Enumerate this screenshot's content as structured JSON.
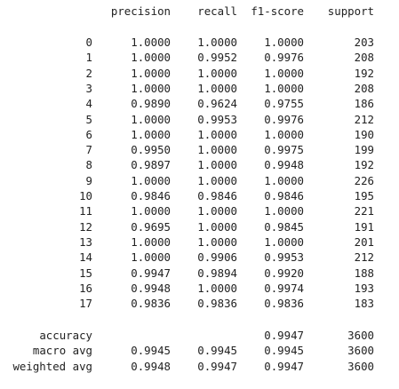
{
  "report": {
    "header": {
      "precision": "precision",
      "recall": "recall",
      "f1": "f1-score",
      "support": "support"
    },
    "classes": [
      {
        "label": "0",
        "precision": "1.0000",
        "recall": "1.0000",
        "f1": "1.0000",
        "support": "203"
      },
      {
        "label": "1",
        "precision": "1.0000",
        "recall": "0.9952",
        "f1": "0.9976",
        "support": "208"
      },
      {
        "label": "2",
        "precision": "1.0000",
        "recall": "1.0000",
        "f1": "1.0000",
        "support": "192"
      },
      {
        "label": "3",
        "precision": "1.0000",
        "recall": "1.0000",
        "f1": "1.0000",
        "support": "208"
      },
      {
        "label": "4",
        "precision": "0.9890",
        "recall": "0.9624",
        "f1": "0.9755",
        "support": "186"
      },
      {
        "label": "5",
        "precision": "1.0000",
        "recall": "0.9953",
        "f1": "0.9976",
        "support": "212"
      },
      {
        "label": "6",
        "precision": "1.0000",
        "recall": "1.0000",
        "f1": "1.0000",
        "support": "190"
      },
      {
        "label": "7",
        "precision": "0.9950",
        "recall": "1.0000",
        "f1": "0.9975",
        "support": "199"
      },
      {
        "label": "8",
        "precision": "0.9897",
        "recall": "1.0000",
        "f1": "0.9948",
        "support": "192"
      },
      {
        "label": "9",
        "precision": "1.0000",
        "recall": "1.0000",
        "f1": "1.0000",
        "support": "226"
      },
      {
        "label": "10",
        "precision": "0.9846",
        "recall": "0.9846",
        "f1": "0.9846",
        "support": "195"
      },
      {
        "label": "11",
        "precision": "1.0000",
        "recall": "1.0000",
        "f1": "1.0000",
        "support": "221"
      },
      {
        "label": "12",
        "precision": "0.9695",
        "recall": "1.0000",
        "f1": "0.9845",
        "support": "191"
      },
      {
        "label": "13",
        "precision": "1.0000",
        "recall": "1.0000",
        "f1": "1.0000",
        "support": "201"
      },
      {
        "label": "14",
        "precision": "1.0000",
        "recall": "0.9906",
        "f1": "0.9953",
        "support": "212"
      },
      {
        "label": "15",
        "precision": "0.9947",
        "recall": "0.9894",
        "f1": "0.9920",
        "support": "188"
      },
      {
        "label": "16",
        "precision": "0.9948",
        "recall": "1.0000",
        "f1": "0.9974",
        "support": "193"
      },
      {
        "label": "17",
        "precision": "0.9836",
        "recall": "0.9836",
        "f1": "0.9836",
        "support": "183"
      }
    ],
    "summary": [
      {
        "label": "accuracy",
        "precision": "",
        "recall": "",
        "f1": "0.9947",
        "support": "3600"
      },
      {
        "label": "macro avg",
        "precision": "0.9945",
        "recall": "0.9945",
        "f1": "0.9945",
        "support": "3600"
      },
      {
        "label": "weighted avg",
        "precision": "0.9948",
        "recall": "0.9947",
        "f1": "0.9947",
        "support": "3600"
      }
    ]
  }
}
